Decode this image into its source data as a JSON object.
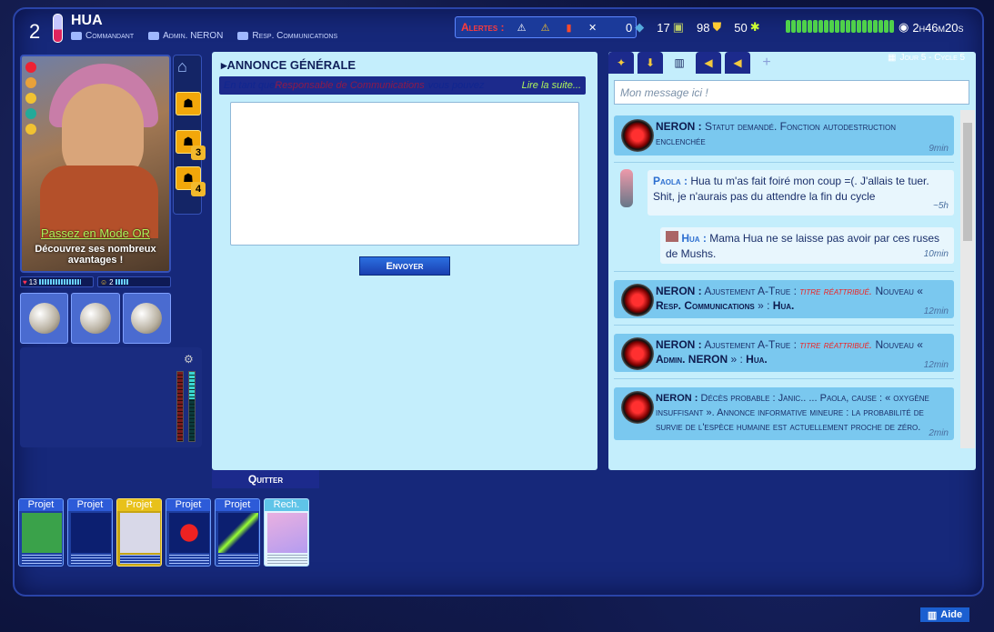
{
  "player": {
    "level": "2",
    "name": "HUA",
    "titles": [
      "Commandant",
      "Admin. NERON",
      "Resp. Communications"
    ]
  },
  "alerts": {
    "label": "Alertes :"
  },
  "stats": {
    "a": "0",
    "b": "17",
    "c": "98",
    "d": "50",
    "time": "2h46m20s",
    "mens_count": 20
  },
  "avatar": {
    "link": "Passez en Mode OR",
    "desc": "Découvrez ses nombreux avantages !"
  },
  "skills": {
    "lock1": "3",
    "lock2": "4"
  },
  "bars": {
    "hp": "13",
    "morale": "2"
  },
  "announcement": {
    "title": "ANNONCE GÉNÉRALE",
    "a": "En tant que ",
    "b": "Responsable de Communications",
    "c": " vous pouvez",
    "more": "Lire la suite...",
    "send": "Envoyer",
    "quit": "Quitter"
  },
  "projects": [
    {
      "label": "Projet"
    },
    {
      "label": "Projet"
    },
    {
      "label": "Projet"
    },
    {
      "label": "Projet"
    },
    {
      "label": "Projet"
    },
    {
      "label": "Rech."
    }
  ],
  "chat": {
    "cycle": "Jour 5 - Cycle 5",
    "placeholder": "Mon message ici !",
    "m1": {
      "who": "NERON :",
      "text": "Statut demandé. Fonction autodestruction enclenchée",
      "time": "9min"
    },
    "m2": {
      "who": "Paola :",
      "text": "Hua tu m'as fait foiré mon coup =(. J'allais te tuer. Shit, je n'aurais pas du attendre la fin du cycle",
      "time": "~5h"
    },
    "m3": {
      "who": "Hua :",
      "text": "Mama Hua ne se laisse pas avoir par ces ruses de Mushs.",
      "time": "10min"
    },
    "m4": {
      "who": "NERON :",
      "t1": "Ajustement A-True :",
      "t2": "titre réattribué.",
      "t3": "Nouveau «",
      "t4": "Resp. Communications",
      "t5": "» :",
      "t6": "Hua.",
      "time": "12min"
    },
    "m5": {
      "who": "NERON :",
      "t1": "Ajustement A-True :",
      "t2": "titre réattribué.",
      "t3": "Nouveau «",
      "t4": "Admin. NERON",
      "t5": "» :",
      "t6": "Hua.",
      "time": "12min"
    },
    "m6": {
      "who": "NERON :",
      "text": "Décès probable : Janic.. ... Paola, cause : « oxygène insuffisant ». Annonce informative mineure : la probabilité de survie de l'espèce humaine est actuellement proche de zéro.",
      "time": "2min"
    }
  },
  "help": "Aide"
}
